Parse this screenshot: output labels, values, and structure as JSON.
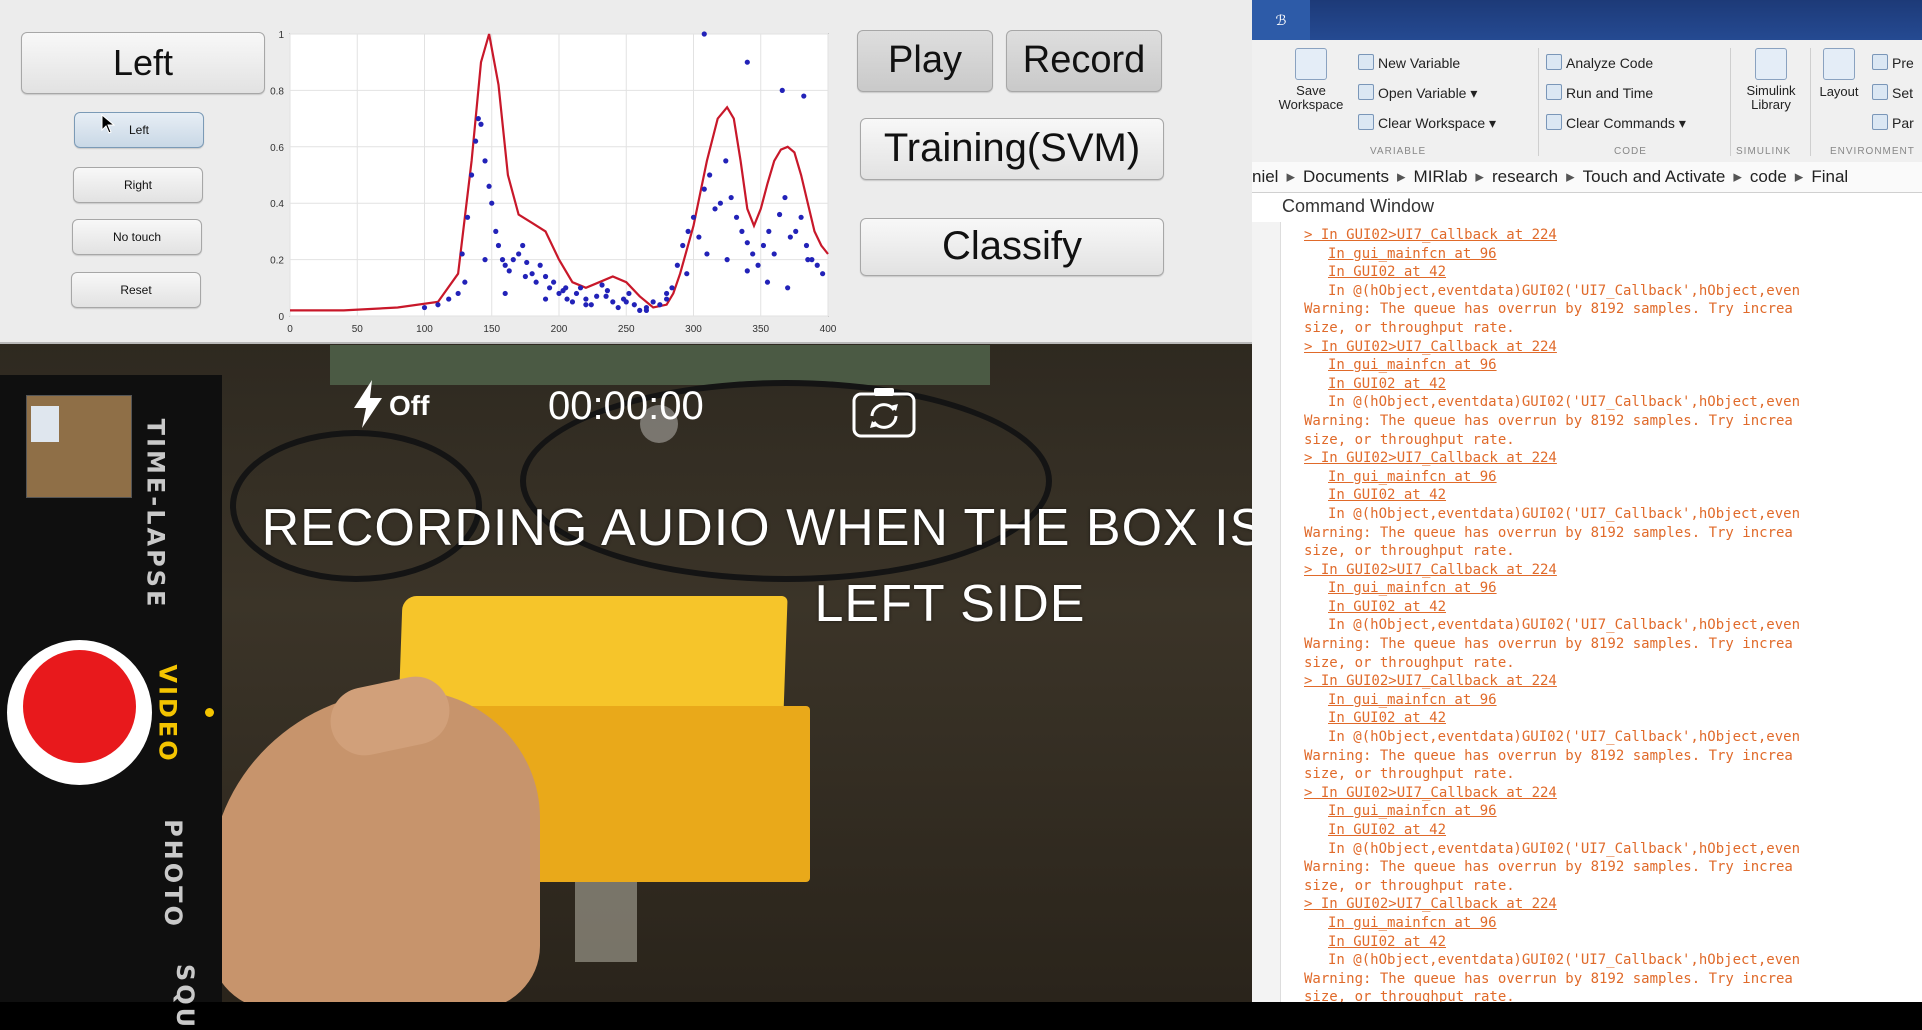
{
  "gui": {
    "label_big": "Left",
    "buttons": [
      "Left",
      "Right",
      "No touch",
      "Reset"
    ],
    "play": "Play",
    "record": "Record",
    "training": "Training(SVM)",
    "classify": "Classify"
  },
  "chart_data": {
    "type": "line",
    "title": "",
    "xlabel": "",
    "ylabel": "",
    "xlim": [
      0,
      400
    ],
    "ylim": [
      0,
      1
    ],
    "xticks": [
      "0",
      "50",
      "100",
      "150",
      "200",
      "250",
      "300",
      "350",
      "400"
    ],
    "yticks": [
      "0",
      "0.2",
      "0.4",
      "0.6",
      "0.8",
      "1"
    ],
    "grid": true,
    "series": [
      {
        "color": "#c8182a",
        "kind": "line",
        "x": [
          0,
          40,
          80,
          110,
          125,
          135,
          142,
          148,
          155,
          162,
          170,
          180,
          190,
          200,
          210,
          220,
          230,
          240,
          250,
          260,
          270,
          280,
          285,
          290,
          300,
          310,
          318,
          325,
          330,
          335,
          340,
          345,
          350,
          355,
          360,
          365,
          370,
          375,
          380,
          385,
          390,
          395,
          400
        ],
        "y": [
          0.02,
          0.02,
          0.03,
          0.05,
          0.15,
          0.55,
          0.9,
          1.0,
          0.82,
          0.5,
          0.36,
          0.33,
          0.3,
          0.2,
          0.12,
          0.1,
          0.12,
          0.14,
          0.12,
          0.07,
          0.03,
          0.04,
          0.08,
          0.15,
          0.32,
          0.55,
          0.7,
          0.74,
          0.7,
          0.55,
          0.38,
          0.32,
          0.38,
          0.47,
          0.55,
          0.59,
          0.6,
          0.58,
          0.5,
          0.4,
          0.3,
          0.25,
          0.22
        ]
      },
      {
        "color": "#2222b8",
        "kind": "scatter",
        "x": [
          100,
          110,
          118,
          125,
          128,
          132,
          135,
          138,
          140,
          142,
          145,
          148,
          150,
          153,
          155,
          158,
          160,
          163,
          166,
          170,
          173,
          176,
          180,
          183,
          186,
          190,
          193,
          196,
          200,
          203,
          206,
          210,
          213,
          216,
          220,
          224,
          228,
          232,
          236,
          240,
          244,
          248,
          252,
          256,
          260,
          265,
          270,
          275,
          280,
          284,
          288,
          292,
          296,
          300,
          304,
          308,
          312,
          316,
          320,
          324,
          328,
          332,
          336,
          340,
          344,
          348,
          352,
          356,
          360,
          364,
          368,
          372,
          376,
          380,
          384,
          388,
          392,
          396,
          340,
          366,
          382,
          308,
          130,
          145,
          160,
          175,
          190,
          205,
          220,
          235,
          250,
          265,
          280,
          295,
          310,
          325,
          340,
          355,
          370,
          385
        ],
        "y": [
          0.03,
          0.04,
          0.06,
          0.08,
          0.22,
          0.35,
          0.5,
          0.62,
          0.7,
          0.68,
          0.55,
          0.46,
          0.4,
          0.3,
          0.25,
          0.2,
          0.18,
          0.16,
          0.2,
          0.22,
          0.25,
          0.19,
          0.15,
          0.12,
          0.18,
          0.14,
          0.1,
          0.12,
          0.08,
          0.09,
          0.06,
          0.05,
          0.08,
          0.1,
          0.06,
          0.04,
          0.07,
          0.11,
          0.09,
          0.05,
          0.03,
          0.06,
          0.08,
          0.04,
          0.02,
          0.03,
          0.05,
          0.04,
          0.06,
          0.1,
          0.18,
          0.25,
          0.3,
          0.35,
          0.28,
          0.45,
          0.5,
          0.38,
          0.4,
          0.55,
          0.42,
          0.35,
          0.3,
          0.26,
          0.22,
          0.18,
          0.25,
          0.3,
          0.22,
          0.36,
          0.42,
          0.28,
          0.3,
          0.35,
          0.25,
          0.2,
          0.18,
          0.15,
          0.9,
          0.8,
          0.78,
          1.0,
          0.12,
          0.2,
          0.08,
          0.14,
          0.06,
          0.1,
          0.04,
          0.07,
          0.05,
          0.02,
          0.08,
          0.15,
          0.22,
          0.2,
          0.16,
          0.12,
          0.1,
          0.2
        ]
      }
    ]
  },
  "camera": {
    "flash_label": "Off",
    "timer": "00:00:00",
    "modes": [
      "TIME-LAPSE",
      "VIDEO",
      "PHOTO",
      "SQU"
    ],
    "caption_line1": "RECORDING AUDIO WHEN THE BOX IS TOUCHED ON",
    "caption_line2": "LEFT SIDE"
  },
  "matlab": {
    "titlebar_chip": "ℬ",
    "toolstrip": {
      "save_workspace": "Save\nWorkspace",
      "new_variable": "New Variable",
      "open_variable": "Open Variable ▾",
      "clear_workspace": "Clear Workspace ▾",
      "analyze_code": "Analyze Code",
      "run_and_time": "Run and Time",
      "clear_commands": "Clear Commands ▾",
      "simulink_library": "Simulink\nLibrary",
      "layout": "Layout",
      "prefs": "Pre",
      "set_path": "Set",
      "parallel": "Par",
      "group_variable": "VARIABLE",
      "group_code": "CODE",
      "group_simulink": "SIMULINK",
      "group_environment": "ENVIRONMENT"
    },
    "path": [
      "niel",
      "Documents",
      "MIRlab",
      "research",
      "Touch and Activate",
      "code",
      "Final"
    ],
    "command_window_title": "Command Window",
    "log_block": [
      "> In GUI02>UI7_Callback at 224",
      "In gui_mainfcn at 96",
      "In GUI02 at 42",
      "In @(hObject,eventdata)GUI02('UI7_Callback',hObject,even",
      "Warning: The queue has overrun by 8192 samples. Try increa",
      "size, or throughput rate."
    ]
  }
}
